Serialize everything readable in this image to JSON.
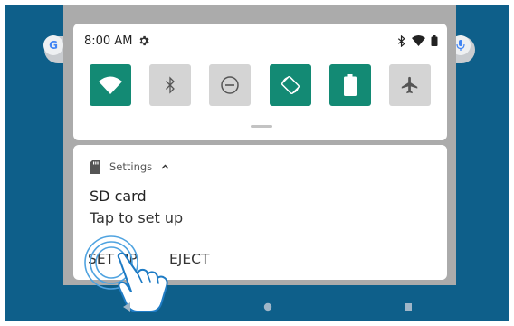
{
  "status_bar": {
    "time": "8:00 AM"
  },
  "search": {
    "logo_letter": "G"
  },
  "quick_settings": {
    "tiles": [
      {
        "name": "wifi",
        "icon": "wifi-icon",
        "state": "on"
      },
      {
        "name": "bluetooth",
        "icon": "bluetooth-icon",
        "state": "off"
      },
      {
        "name": "do-not-disturb",
        "icon": "do-not-disturb-icon",
        "state": "off"
      },
      {
        "name": "auto-rotate",
        "icon": "auto-rotate-icon",
        "state": "on"
      },
      {
        "name": "battery-saver",
        "icon": "battery-icon",
        "state": "on"
      },
      {
        "name": "airplane-mode",
        "icon": "airplane-icon",
        "state": "off"
      }
    ]
  },
  "notification": {
    "app_name": "Settings",
    "title": "SD card",
    "text": "Tap to set up",
    "actions": {
      "primary": "SET UP",
      "secondary": "EJECT"
    }
  },
  "colors": {
    "accent": "#138a74",
    "wallpaper": "#0e5f8a",
    "shade_backdrop": "#ababab"
  }
}
